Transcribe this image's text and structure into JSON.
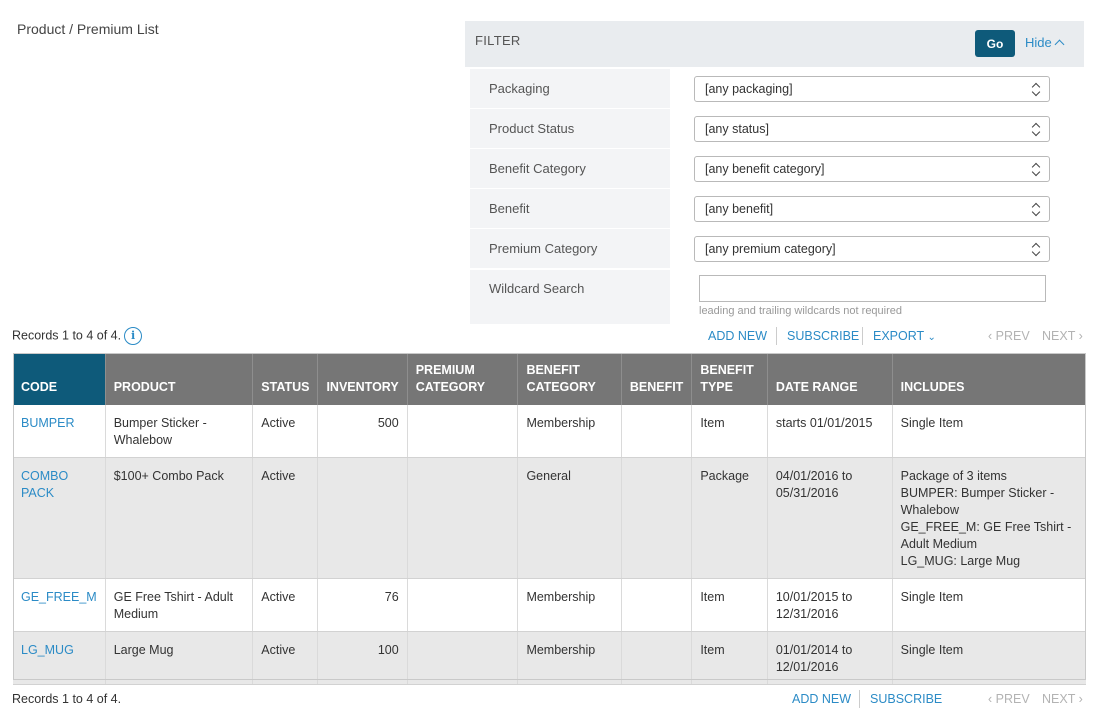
{
  "page": {
    "title": "Product / Premium List"
  },
  "filter": {
    "title": "FILTER",
    "go_label": "Go",
    "hide_label": "Hide",
    "rows": [
      {
        "label": "Packaging",
        "value": "[any packaging]"
      },
      {
        "label": "Product Status",
        "value": "[any status]"
      },
      {
        "label": "Benefit Category",
        "value": "[any benefit category]"
      },
      {
        "label": "Benefit",
        "value": "[any benefit]"
      },
      {
        "label": "Premium Category",
        "value": "[any premium category]"
      }
    ],
    "wildcard": {
      "label": "Wildcard Search",
      "value": "",
      "hint": "leading and trailing wildcards not required"
    }
  },
  "top_bar": {
    "records": "Records 1 to 4 of 4.",
    "add_new": "ADD NEW",
    "subscribe": "SUBSCRIBE",
    "export": "EXPORT",
    "prev": "PREV",
    "next": "NEXT"
  },
  "bottom_bar": {
    "records": "Records 1 to 4 of 4.",
    "add_new": "ADD NEW",
    "subscribe": "SUBSCRIBE",
    "prev": "PREV",
    "next": "NEXT"
  },
  "table": {
    "headers": {
      "code": "CODE",
      "product": "PRODUCT",
      "status": "STATUS",
      "inventory": "INVENTORY",
      "premium_category_1": "PREMIUM",
      "premium_category_2": "CATEGORY",
      "benefit_category_1": "BENEFIT",
      "benefit_category_2": "CATEGORY",
      "benefit": "BENEFIT",
      "benefit_type_1": "BENEFIT",
      "benefit_type_2": "TYPE",
      "date_range": "DATE RANGE",
      "includes": "INCLUDES"
    },
    "rows": [
      {
        "code": "BUMPER",
        "product": [
          "Bumper Sticker -",
          "Whalebow"
        ],
        "status": "Active",
        "inventory": "500",
        "premium_category": "",
        "benefit_category": "Membership",
        "benefit": "",
        "benefit_type": "Item",
        "date_range": [
          "starts 01/01/2015"
        ],
        "includes": [
          "Single Item"
        ]
      },
      {
        "code": [
          "COMBO",
          "PACK"
        ],
        "product": [
          "$100+ Combo Pack"
        ],
        "status": "Active",
        "inventory": "",
        "premium_category": "",
        "benefit_category": "General",
        "benefit": "",
        "benefit_type": "Package",
        "date_range": [
          "04/01/2016 to",
          "05/31/2016"
        ],
        "includes": [
          "Package of 3 items",
          "BUMPER: Bumper Sticker -",
          "Whalebow",
          "GE_FREE_M: GE Free Tshirt -",
          "Adult Medium",
          "LG_MUG: Large Mug"
        ]
      },
      {
        "code": "GE_FREE_M",
        "product": [
          "GE Free Tshirt - Adult",
          "Medium"
        ],
        "status": "Active",
        "inventory": "76",
        "premium_category": "",
        "benefit_category": "Membership",
        "benefit": "",
        "benefit_type": "Item",
        "date_range": [
          "10/01/2015 to",
          "12/31/2016"
        ],
        "includes": [
          "Single Item"
        ]
      },
      {
        "code": "LG_MUG",
        "product": [
          "Large Mug"
        ],
        "status": "Active",
        "inventory": "100",
        "premium_category": "",
        "benefit_category": "Membership",
        "benefit": "",
        "benefit_type": "Item",
        "date_range": [
          "01/01/2014 to",
          "12/01/2016"
        ],
        "includes": [
          "Single Item"
        ]
      }
    ]
  },
  "colors": {
    "brand_dark": "#0e5a7a",
    "link": "#2b8bc6",
    "header_gray": "#767676",
    "alt_row": "#e8e8e8"
  }
}
